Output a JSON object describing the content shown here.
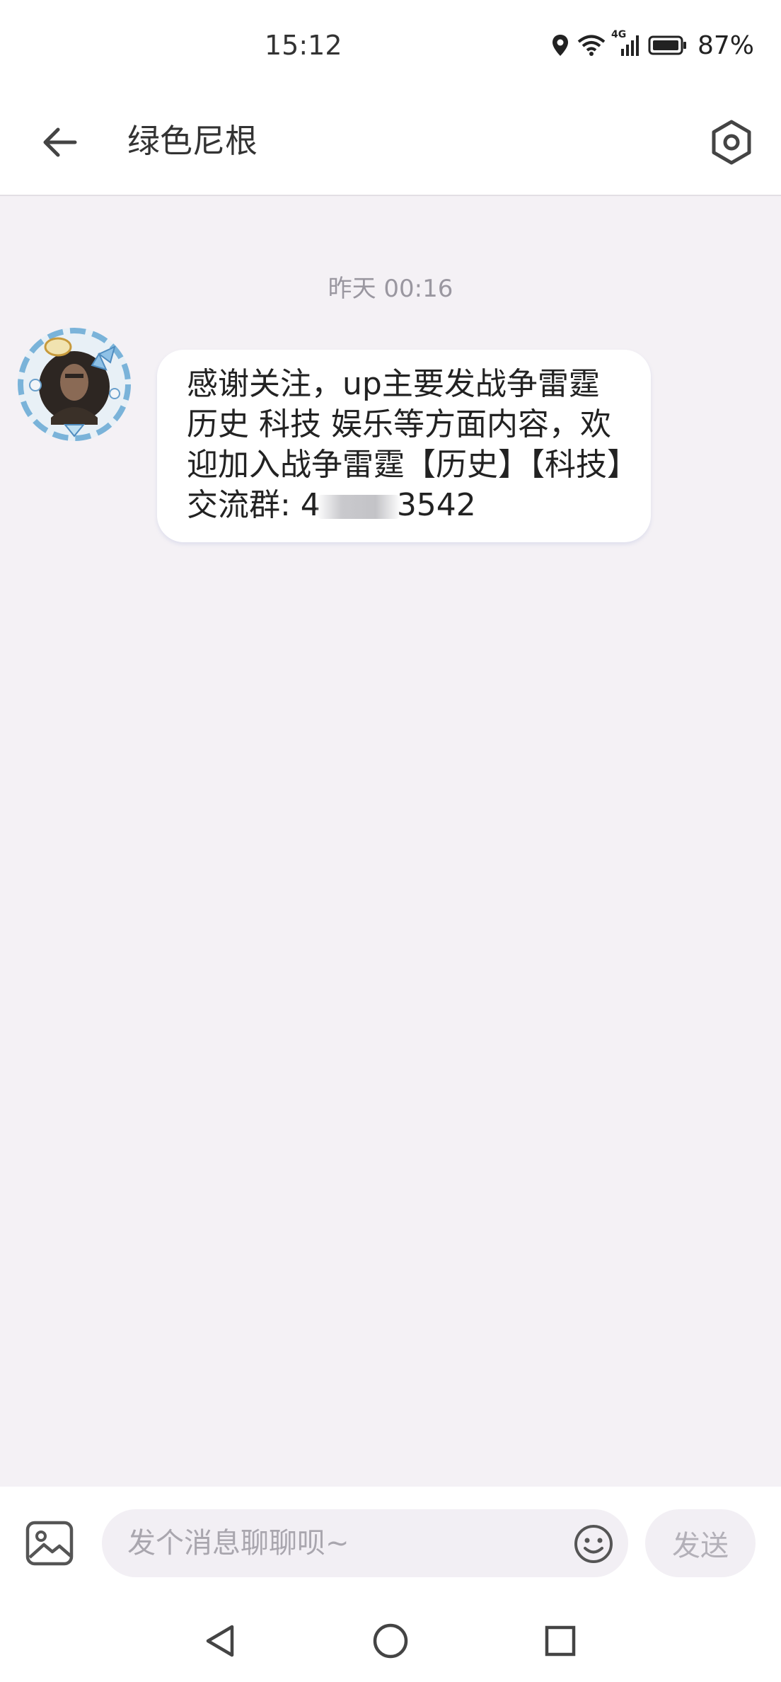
{
  "status_bar": {
    "time": "15:12",
    "network": "4G",
    "battery": "87%"
  },
  "header": {
    "title": "绿色尼根"
  },
  "chat": {
    "timestamp": "昨天 00:16",
    "message": {
      "text_before_redaction": "感谢关注，up主要发战争雷霆 历史 科技 娱乐等方面内容，欢迎加入战争雷霆【历史】【科技】交流群: 4",
      "text_after_redaction": "3542"
    }
  },
  "input_bar": {
    "placeholder": "发个消息聊聊呗~",
    "send_label": "发送"
  },
  "colors": {
    "chat_background": "#f4f1f5",
    "bubble": "#ffffff",
    "timestamp": "#9a97a0"
  },
  "icons": {
    "back": "arrow-left-icon",
    "settings": "hexagon-settings-icon",
    "image": "image-icon",
    "emoji": "smiley-icon"
  }
}
